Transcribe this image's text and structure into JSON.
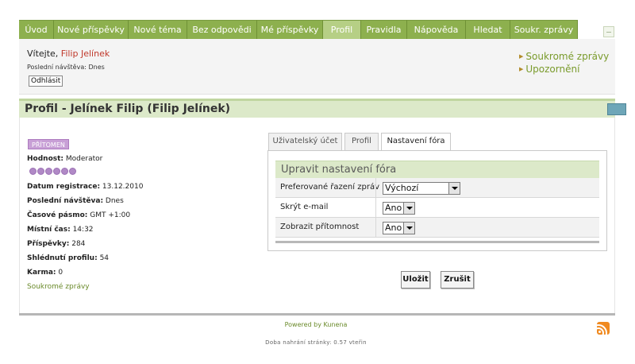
{
  "nav": {
    "tabs": [
      {
        "label": "Úvod",
        "active": false
      },
      {
        "label": "Nové příspěvky",
        "active": false
      },
      {
        "label": "Nové téma",
        "active": false
      },
      {
        "label": "Bez odpovědi",
        "active": false
      },
      {
        "label": "Mé příspěvky",
        "active": false
      },
      {
        "label": "Profil",
        "active": true
      },
      {
        "label": "Pravidla",
        "active": false
      },
      {
        "label": "Nápověda",
        "active": false
      },
      {
        "label": "Hledat",
        "active": false
      },
      {
        "label": "Soukr. zprávy",
        "active": false
      }
    ],
    "colors": {
      "tab": "#8db04e",
      "active_tab": "#b6cf85"
    }
  },
  "welcome": {
    "greeting": "Vítejte, ",
    "username": "Filip Jelínek",
    "last_visit": "Poslední návštěva: Dnes",
    "logout": "Odhlásit",
    "links": [
      "Soukromé zprávy",
      "Upozornění"
    ]
  },
  "profile": {
    "title": "Profil - Jelínek Filip (Filip Jelínek)",
    "status": "PŘÍTOMEN",
    "rank_label": "Hodnost:",
    "rank": "Moderator",
    "rank_stars": 6,
    "fields": [
      {
        "label": "Datum registrace:",
        "value": "13.12.2010"
      },
      {
        "label": "Poslední návštěva:",
        "value": "Dnes"
      },
      {
        "label": "Časové pásmo:",
        "value": "GMT +1:00"
      },
      {
        "label": "Místní čas:",
        "value": "14:32"
      },
      {
        "label": "Příspěvky:",
        "value": "284"
      },
      {
        "label": "Shlédnutí profilu:",
        "value": "54"
      },
      {
        "label": "Karma:",
        "value": "0"
      }
    ],
    "pm_link": "Soukromé zprávy"
  },
  "tabs": [
    {
      "label": "Uživatelský účet",
      "active": false
    },
    {
      "label": "Profil",
      "active": false
    },
    {
      "label": "Nastavení fóra",
      "active": true
    }
  ],
  "settings": {
    "title": "Upravit nastavení fóra",
    "rows": [
      {
        "label": "Preferované řazení zpráv",
        "value": "Výchozí"
      },
      {
        "label": "Skrýt e-mail",
        "value": "Ano"
      },
      {
        "label": "Zobrazit přítomnost",
        "value": "Ano"
      }
    ]
  },
  "actions": {
    "save": "Uložit",
    "cancel": "Zrušit"
  },
  "footer": {
    "powered": "Powered by Kunena",
    "load_time": "Doba nahrání stránky: 0.57 vteřin"
  }
}
